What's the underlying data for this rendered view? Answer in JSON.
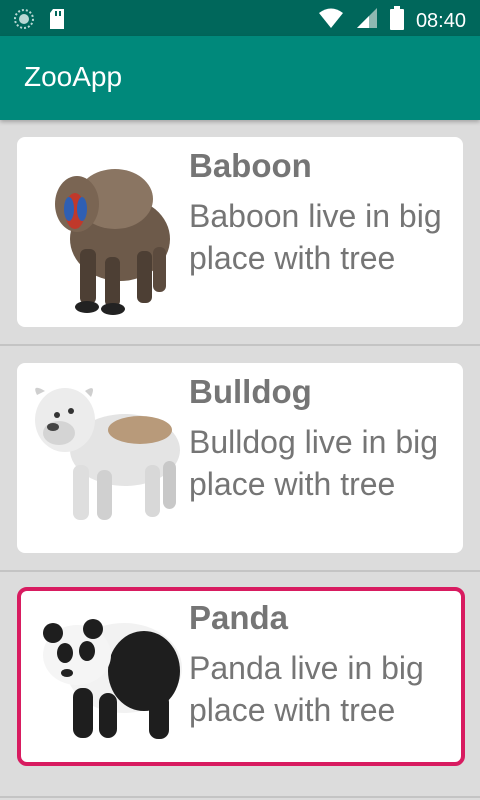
{
  "status_bar": {
    "time": "08:40",
    "icons": [
      "android-circle-icon",
      "sd-card-icon",
      "wifi-icon",
      "signal-icon",
      "battery-icon"
    ]
  },
  "app_bar": {
    "title": "ZooApp"
  },
  "colors": {
    "status_bar": "#00675b",
    "app_bar": "#00897b",
    "background": "#dcdcdc",
    "selected_border": "#d81b60",
    "text_gray": "#757575"
  },
  "animals": [
    {
      "name": "Baboon",
      "description": "Baboon live in big place with tree",
      "image": "baboon-image",
      "selected": false
    },
    {
      "name": "Bulldog",
      "description": "Bulldog live in big place with tree",
      "image": "bulldog-image",
      "selected": false
    },
    {
      "name": "Panda",
      "description": "Panda live in  big place with tree",
      "image": "panda-image",
      "selected": true
    }
  ]
}
